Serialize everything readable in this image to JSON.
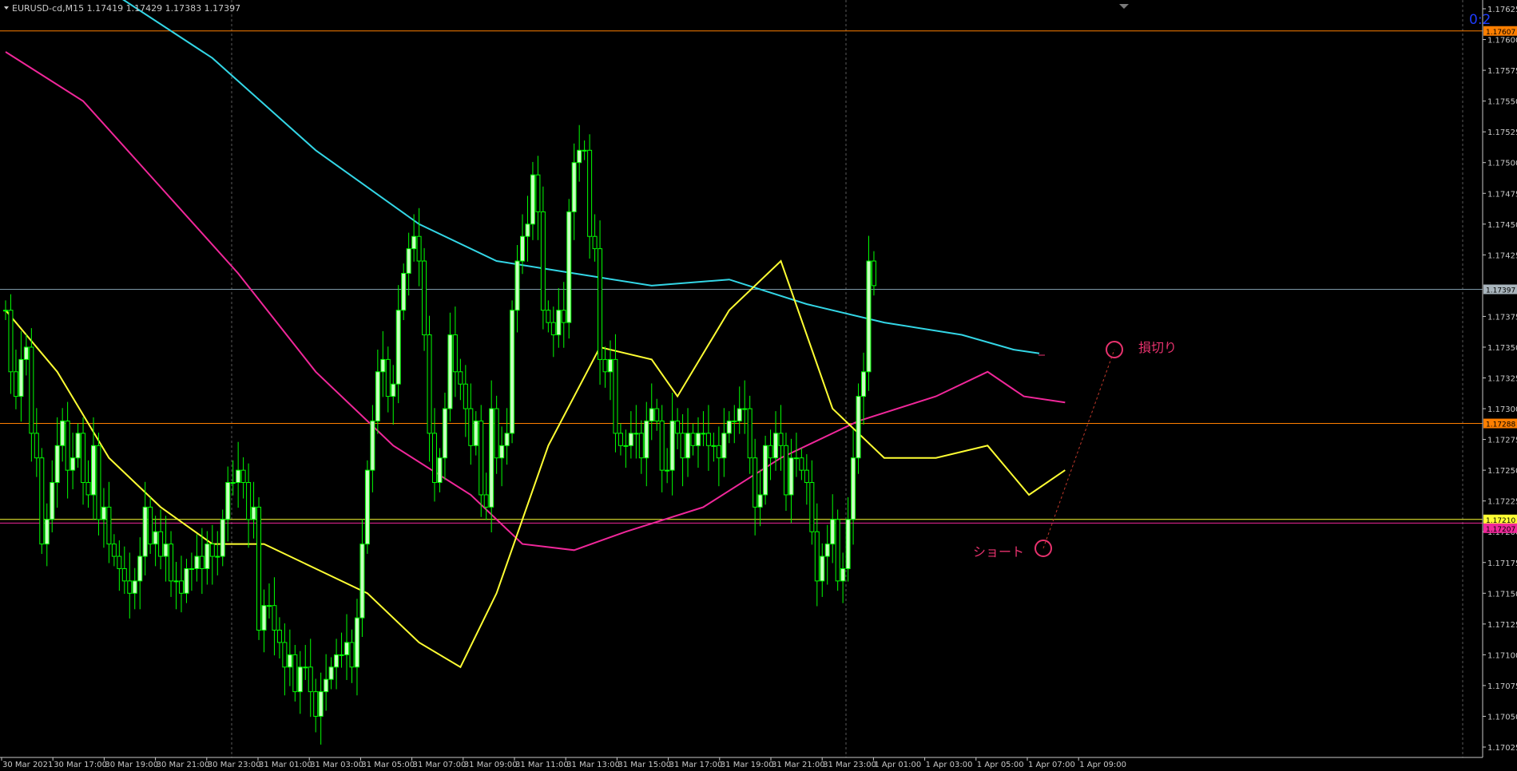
{
  "window": {
    "symbol_header": "EURUSD-cd,M15  1.17419 1.17429 1.17383 1.17397",
    "countdown": "0:2",
    "menu_arrow": "triangle-down-icon"
  },
  "colors": {
    "background": "#000000",
    "candle": "#00ff00",
    "candle_bull_body": "#c8ffc0",
    "ma_cyan": "#33d6e6",
    "ma_magenta": "#f0279a",
    "ma_yellow": "#ffff33",
    "level_orange": "#ff7f00",
    "bid_line": "#7e99a8",
    "annotation": "#e8326e",
    "grid": "#5a5a5a",
    "axis_text": "#c8c8c8",
    "countdown": "#1e3cff"
  },
  "price_axis": {
    "labels": [
      "1.17625",
      "1.17600",
      "1.17575",
      "1.17550",
      "1.17525",
      "1.17500",
      "1.17475",
      "1.17450",
      "1.17425",
      "1.17375",
      "1.17350",
      "1.17325",
      "1.17300",
      "1.17275",
      "1.17250",
      "1.17225",
      "1.17200",
      "1.17175",
      "1.17150",
      "1.17125",
      "1.17100",
      "1.17075",
      "1.17050",
      "1.17025"
    ]
  },
  "price_tags": [
    {
      "text": "1.17607",
      "value": 1.17607,
      "kind": "orange"
    },
    {
      "text": "1.17397",
      "value": 1.17397,
      "kind": "bid"
    },
    {
      "text": "1.17288",
      "value": 1.17288,
      "kind": "orange"
    },
    {
      "text": "1.17210",
      "value": 1.1721,
      "kind": "yellow"
    },
    {
      "text": "1.17207",
      "value": 1.17207,
      "kind": "magenta"
    }
  ],
  "time_axis": {
    "labels": [
      "30 Mar 2021",
      "30 Mar 17:00",
      "30 Mar 19:00",
      "30 Mar 21:00",
      "30 Mar 23:00",
      "31 Mar 01:00",
      "31 Mar 03:00",
      "31 Mar 05:00",
      "31 Mar 07:00",
      "31 Mar 09:00",
      "31 Mar 11:00",
      "31 Mar 13:00",
      "31 Mar 15:00",
      "31 Mar 17:00",
      "31 Mar 19:00",
      "31 Mar 21:00",
      "31 Mar 23:00",
      "1 Apr 01:00",
      "1 Apr 03:00",
      "1 Apr 05:00",
      "1 Apr 07:00",
      "1 Apr 09:00"
    ]
  },
  "annotations": {
    "short_label": "ショート",
    "stop_label": "損切り"
  },
  "chart_data": {
    "type": "candlestick",
    "symbol": "EURUSD-cd",
    "timeframe": "M15",
    "ohlc_header": {
      "open": 1.17419,
      "high": 1.17429,
      "low": 1.17383,
      "close": 1.17397
    },
    "ylim": [
      1.17025,
      1.1763
    ],
    "horizontal_levels": [
      1.17607,
      1.17288,
      1.1721,
      1.17207
    ],
    "current_price": 1.17397,
    "x_tick_labels": [
      "30 Mar 2021",
      "30 Mar 17:00",
      "30 Mar 19:00",
      "30 Mar 21:00",
      "30 Mar 23:00",
      "31 Mar 01:00",
      "31 Mar 03:00",
      "31 Mar 05:00",
      "31 Mar 07:00",
      "31 Mar 09:00",
      "31 Mar 11:00",
      "31 Mar 13:00",
      "31 Mar 15:00",
      "31 Mar 17:00",
      "31 Mar 19:00",
      "31 Mar 21:00",
      "31 Mar 23:00",
      "1 Apr 01:00",
      "1 Apr 03:00",
      "1 Apr 05:00",
      "1 Apr 07:00",
      "1 Apr 09:00"
    ],
    "closes": [
      1.1738,
      1.1733,
      1.1731,
      1.1734,
      1.1735,
      1.1728,
      1.1726,
      1.1719,
      1.1721,
      1.1724,
      1.1727,
      1.1729,
      1.1725,
      1.1726,
      1.1728,
      1.1724,
      1.1723,
      1.1727,
      1.1721,
      1.1722,
      1.1719,
      1.1718,
      1.1717,
      1.1716,
      1.1715,
      1.1716,
      1.1718,
      1.1722,
      1.1719,
      1.172,
      1.1718,
      1.1719,
      1.1716,
      1.1716,
      1.1715,
      1.1717,
      1.1717,
      1.1718,
      1.1717,
      1.1719,
      1.1718,
      1.1718,
      1.1721,
      1.1724,
      1.1724,
      1.1725,
      1.1724,
      1.1721,
      1.1722,
      1.1712,
      1.1714,
      1.1714,
      1.1712,
      1.1711,
      1.1709,
      1.171,
      1.1707,
      1.1709,
      1.1709,
      1.1707,
      1.1705,
      1.1707,
      1.1708,
      1.1709,
      1.171,
      1.171,
      1.1711,
      1.1709,
      1.1713,
      1.1719,
      1.1725,
      1.1729,
      1.1733,
      1.1734,
      1.1731,
      1.1732,
      1.1738,
      1.1741,
      1.1743,
      1.1744,
      1.1742,
      1.1736,
      1.1728,
      1.1724,
      1.1726,
      1.173,
      1.1736,
      1.1733,
      1.1732,
      1.173,
      1.1727,
      1.1729,
      1.1723,
      1.1722,
      1.173,
      1.1726,
      1.1727,
      1.1728,
      1.1738,
      1.1742,
      1.1744,
      1.1745,
      1.1749,
      1.1746,
      1.1738,
      1.1737,
      1.1736,
      1.1738,
      1.1737,
      1.1746,
      1.175,
      1.1751,
      1.1751,
      1.1744,
      1.1743,
      1.1734,
      1.1733,
      1.1734,
      1.1728,
      1.1727,
      1.1727,
      1.1728,
      1.1728,
      1.1726,
      1.1729,
      1.173,
      1.1729,
      1.1725,
      1.1725,
      1.1729,
      1.1728,
      1.1726,
      1.1728,
      1.1727,
      1.1728,
      1.1728,
      1.1727,
      1.1727,
      1.1726,
      1.1728,
      1.1729,
      1.1729,
      1.173,
      1.173,
      1.1726,
      1.1722,
      1.1723,
      1.1727,
      1.1726,
      1.1728,
      1.1727,
      1.1723,
      1.1726,
      1.1726,
      1.1725,
      1.1724,
      1.172,
      1.1716,
      1.1718,
      1.1719,
      1.1721,
      1.1716,
      1.1717,
      1.1721,
      1.1726,
      1.1731,
      1.1733,
      1.1742,
      1.174
    ],
    "series": [
      {
        "name": "MA cyan",
        "color": "#33d6e6",
        "values": [
          [
            0,
            1.1769
          ],
          [
            20,
            1.1764
          ],
          [
            40,
            1.17585
          ],
          [
            60,
            1.1751
          ],
          [
            80,
            1.1745
          ],
          [
            95,
            1.1742
          ],
          [
            110,
            1.1741
          ],
          [
            125,
            1.174
          ],
          [
            140,
            1.17405
          ],
          [
            155,
            1.17385
          ],
          [
            170,
            1.1737
          ],
          [
            185,
            1.1736
          ],
          [
            195,
            1.17348
          ],
          [
            200,
            1.17345
          ]
        ]
      },
      {
        "name": "MA magenta",
        "color": "#f0279a",
        "values": [
          [
            0,
            1.1759
          ],
          [
            15,
            1.1755
          ],
          [
            30,
            1.1748
          ],
          [
            45,
            1.1741
          ],
          [
            60,
            1.1733
          ],
          [
            75,
            1.1727
          ],
          [
            90,
            1.1723
          ],
          [
            100,
            1.1719
          ],
          [
            110,
            1.17185
          ],
          [
            120,
            1.172
          ],
          [
            135,
            1.1722
          ],
          [
            150,
            1.1726
          ],
          [
            165,
            1.1729
          ],
          [
            180,
            1.1731
          ],
          [
            190,
            1.1733
          ],
          [
            197,
            1.1731
          ],
          [
            205,
            1.17305
          ]
        ]
      },
      {
        "name": "MA yellow",
        "color": "#ffff33",
        "values": [
          [
            0,
            1.1738
          ],
          [
            10,
            1.1733
          ],
          [
            20,
            1.1726
          ],
          [
            30,
            1.1722
          ],
          [
            40,
            1.1719
          ],
          [
            50,
            1.1719
          ],
          [
            60,
            1.1717
          ],
          [
            70,
            1.1715
          ],
          [
            80,
            1.1711
          ],
          [
            88,
            1.1709
          ],
          [
            95,
            1.1715
          ],
          [
            105,
            1.1727
          ],
          [
            115,
            1.1735
          ],
          [
            125,
            1.1734
          ],
          [
            130,
            1.1731
          ],
          [
            140,
            1.1738
          ],
          [
            150,
            1.1742
          ],
          [
            160,
            1.173
          ],
          [
            170,
            1.1726
          ],
          [
            180,
            1.1726
          ],
          [
            190,
            1.1727
          ],
          [
            198,
            1.1723
          ],
          [
            205,
            1.1725
          ]
        ]
      }
    ]
  }
}
